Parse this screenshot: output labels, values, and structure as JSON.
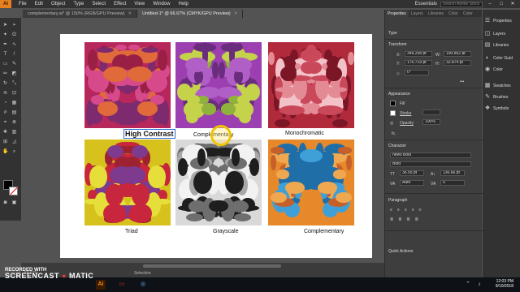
{
  "menubar": {
    "logo": "Ai",
    "items": [
      "File",
      "Edit",
      "Object",
      "Type",
      "Select",
      "Effect",
      "View",
      "Window",
      "Help"
    ],
    "workspace": "Essentials",
    "search_placeholder": "Search Adobe Stock"
  },
  "tabs": [
    {
      "label": "complementary.ai* @ 150% (RGB/GPU Preview)",
      "active": false
    },
    {
      "label": "Untitled-1* @ 66.67% (CMYK/GPU Preview)",
      "active": true
    }
  ],
  "artboard": {
    "captions": [
      "High Contrast",
      "Complementary",
      "Monochromatic",
      "Triad",
      "Grayscale",
      "Complementary"
    ],
    "tile_colors": [
      [
        "#b8275c",
        "#d64a8b",
        "#7d2a6e",
        "#e06a3a",
        "#9a1f45"
      ],
      [
        "#9c3fb0",
        "#8fb33a",
        "#c4d34a",
        "#6a2c7d",
        "#b05fc6"
      ],
      [
        "#b02a3c",
        "#e38a95",
        "#7a1626",
        "#f3c2c8",
        "#c9485a"
      ],
      [
        "#d7c21d",
        "#c8263c",
        "#7d3a8e",
        "#e6df3a",
        "#9c2232"
      ],
      [
        "#d9d9d9",
        "#6e6e6e",
        "#1e1e1e",
        "#a8a8a8",
        "#f2f2f2"
      ],
      [
        "#e7892a",
        "#3fa0d8",
        "#f0a850",
        "#1f6ea8",
        "#c6602a"
      ]
    ]
  },
  "statusbar": {
    "zoom": "66.67%",
    "tool": "Selection"
  },
  "properties": {
    "tabs": [
      "Properties",
      "Layers",
      "Libraries",
      "Color",
      "Color"
    ],
    "type_label": "Type",
    "transform_label": "Transform",
    "x": "349.208 pt",
    "y": "176.719 pt",
    "w": "190.852 pt",
    "h": "32.874 pt",
    "rotate": "0°",
    "appearance_label": "Appearance",
    "fill_label": "Fill",
    "stroke_label": "Stroke",
    "opacity_label": "Opacity",
    "opacity": "100%",
    "fx": "fx.",
    "character_label": "Character",
    "font_family": "news Bold",
    "font_style": "Bold",
    "font_size": "36.55 pt",
    "leading": "136.66 pt",
    "tracking": "Auto",
    "kerning": "0",
    "paragraph_label": "Paragraph",
    "quick_actions_label": "Quick Actions"
  },
  "dock": {
    "items": [
      "Properties",
      "Layers",
      "Libraries",
      "Color Guid",
      "Color",
      "Swatches",
      "Brushes",
      "Symbols"
    ]
  },
  "watermark": {
    "line1": "RECORDED WITH",
    "line2": "SCREENCAST",
    "line3": "MATIC"
  },
  "clock": {
    "time": "12:03 PM",
    "date": "9/10/2018"
  }
}
